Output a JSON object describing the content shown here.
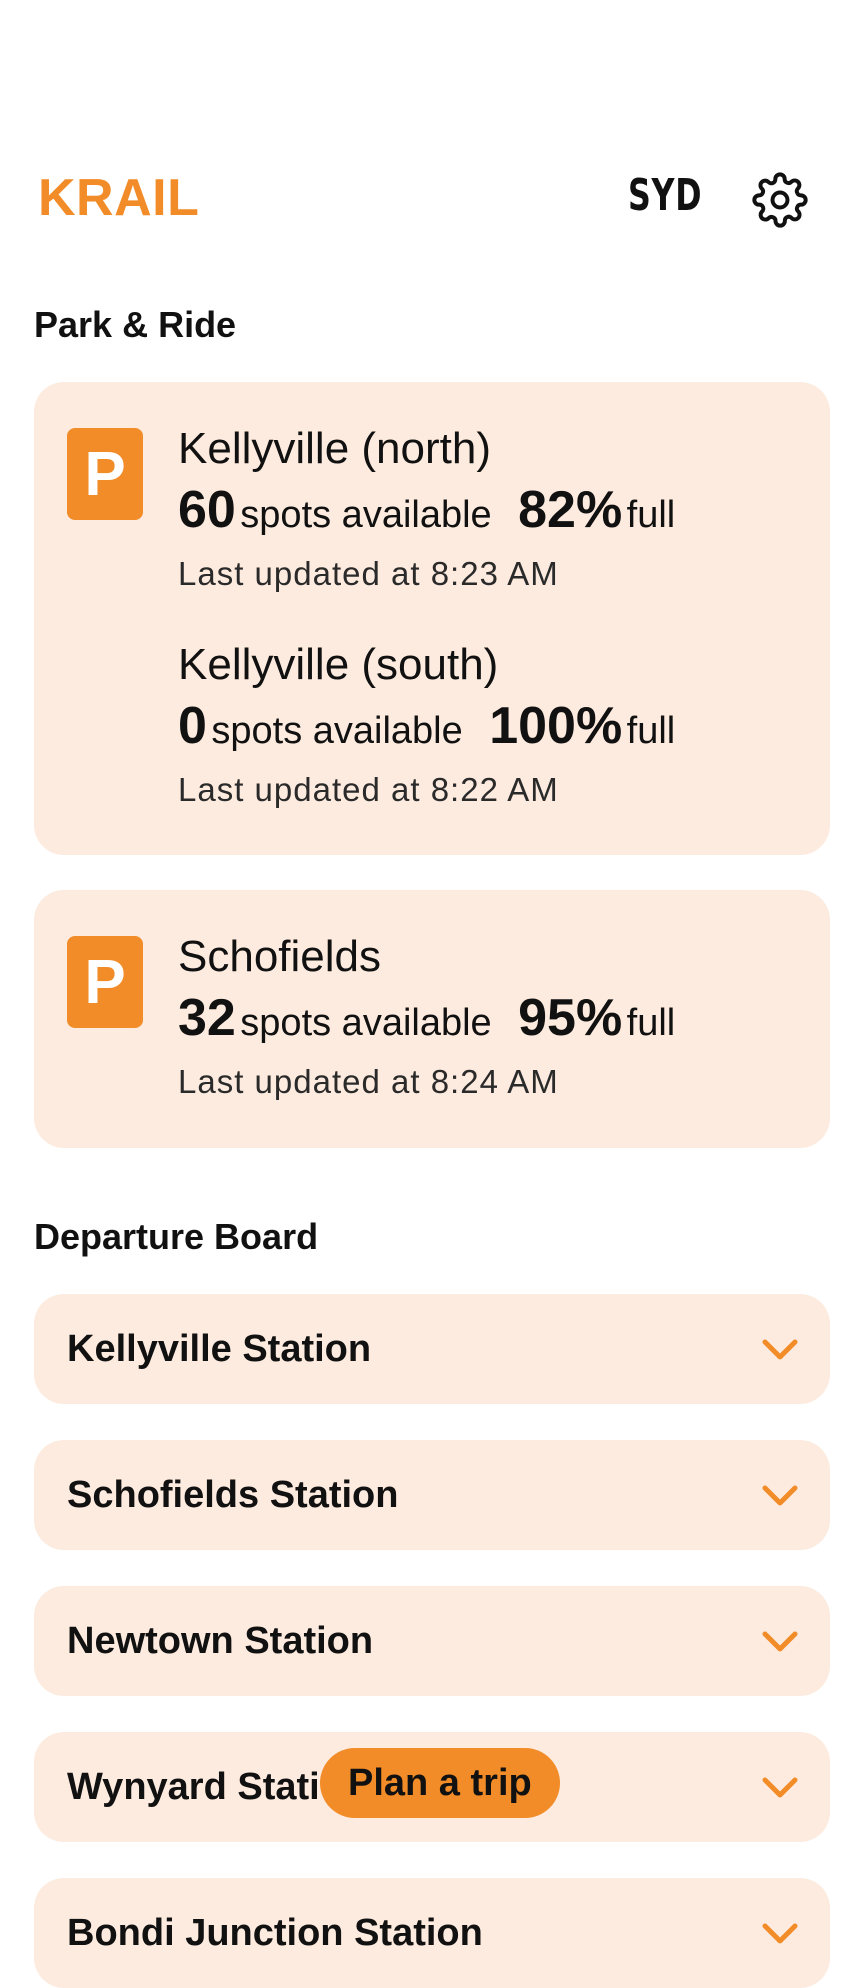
{
  "theme": {
    "accent": "#F28C28",
    "card_bg": "#FDEBDF",
    "text": "#111111"
  },
  "header": {
    "brand": "KRAIL",
    "city": "SYD",
    "settings_icon": "gear-icon"
  },
  "park_ride": {
    "title": "Park & Ride",
    "cards": [
      {
        "badge": "P",
        "lots": [
          {
            "name": "Kellyville (north)",
            "spots": "60",
            "spots_label": "spots available",
            "percent": "82%",
            "full_label": "full",
            "updated": "Last updated at 8:23 AM"
          },
          {
            "name": "Kellyville (south)",
            "spots": "0",
            "spots_label": "spots available",
            "percent": "100%",
            "full_label": "full",
            "updated": "Last updated at 8:22 AM"
          }
        ]
      },
      {
        "badge": "P",
        "lots": [
          {
            "name": "Schofields",
            "spots": "32",
            "spots_label": "spots available",
            "percent": "95%",
            "full_label": "full",
            "updated": "Last updated at 8:24 AM"
          }
        ]
      }
    ]
  },
  "departures": {
    "title": "Departure Board",
    "stations": [
      {
        "name": "Kellyville Station",
        "icon": "chevron-down-icon"
      },
      {
        "name": "Schofields Station",
        "icon": "chevron-down-icon"
      },
      {
        "name": "Newtown Station",
        "icon": "chevron-down-icon"
      },
      {
        "name": "Wynyard Station",
        "icon": "chevron-down-icon"
      },
      {
        "name": "Bondi Junction Station",
        "icon": "chevron-down-icon"
      }
    ]
  },
  "fab": {
    "label": "Plan a trip"
  }
}
